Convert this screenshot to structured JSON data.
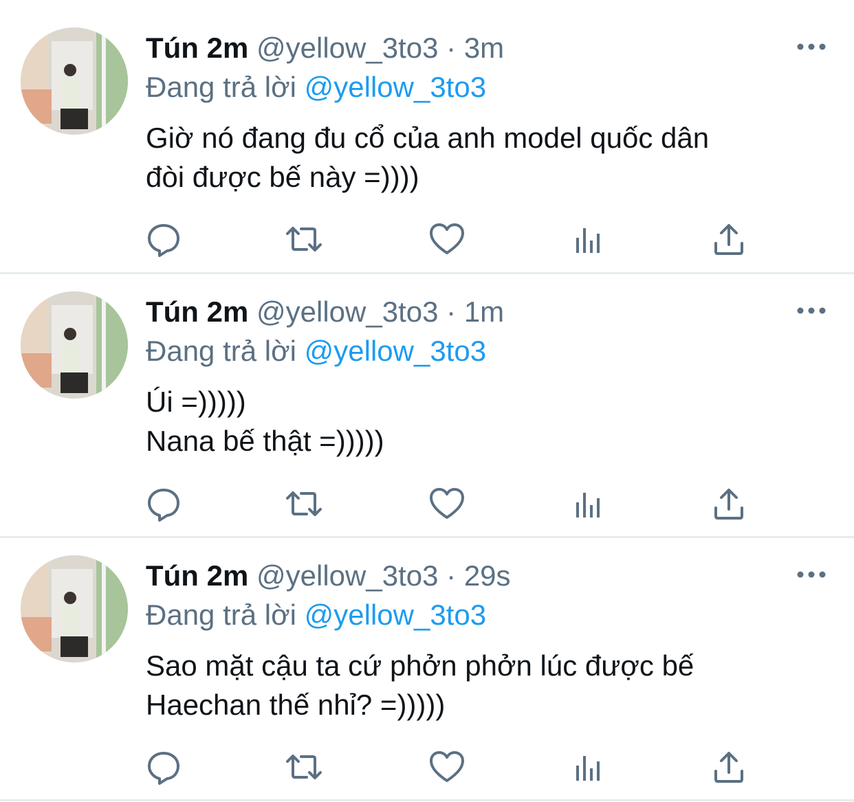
{
  "feed": {
    "tweets": [
      {
        "display_name": "Tún 2m",
        "handle": "@yellow_3to3",
        "separator": "·",
        "time": "3m",
        "reply_prefix": "Đang trả lời",
        "reply_to": "@yellow_3to3",
        "body_lines": [
          "Giờ nó đang đu cổ của anh model quốc dân",
          "đòi được bế này =))))"
        ]
      },
      {
        "display_name": "Tún 2m",
        "handle": "@yellow_3to3",
        "separator": "·",
        "time": "1m",
        "reply_prefix": "Đang trả lời",
        "reply_to": "@yellow_3to3",
        "body_lines": [
          "Úi =)))))",
          "Nana bế thật =)))))"
        ]
      },
      {
        "display_name": "Tún 2m",
        "handle": "@yellow_3to3",
        "separator": "·",
        "time": "29s",
        "reply_prefix": "Đang trả lời",
        "reply_to": "@yellow_3to3",
        "body_lines": [
          "Sao mặt cậu ta cứ phởn phởn lúc được bế",
          "Haechan thế nhỉ? =)))))"
        ]
      }
    ]
  },
  "icons": {
    "more": "more-horizontal-icon",
    "reply": "reply-icon",
    "retweet": "retweet-icon",
    "like": "like-icon",
    "analytics": "analytics-icon",
    "share": "share-icon"
  },
  "colors": {
    "text": "#0f1419",
    "secondary": "#5b7083",
    "link": "#1d9bf0",
    "divider": "#e6ecf0"
  }
}
